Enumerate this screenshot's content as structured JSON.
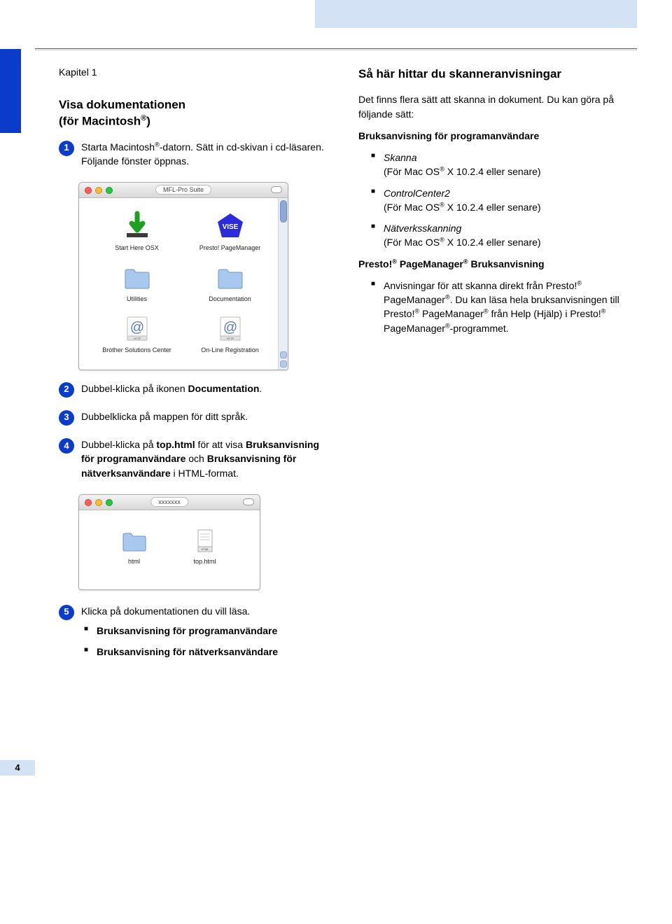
{
  "chapter_label": "Kapitel 1",
  "left": {
    "heading_prefix": "Visa dokumentationen",
    "heading_for": "(för Macintosh",
    "heading_close": ")",
    "step1_a": "Starta Macintosh",
    "step1_b": "-datorn. Sätt in cd-skivan i cd-läsaren. Följande fönster öppnas.",
    "window1_title": "MFL-Pro Suite",
    "items": {
      "start_here": "Start Here OSX",
      "presto": "Presto! PageManager",
      "utilities": "Utilities",
      "documentation": "Documentation",
      "solutions": "Brother Solutions Center",
      "online": "On-Line Registration"
    },
    "step2_a": "Dubbel-klicka på ikonen ",
    "step2_b": "Documentation",
    "step2_c": ".",
    "step3": "Dubbelklicka på mappen för ditt språk.",
    "step4_a": "Dubbel-klicka på ",
    "step4_b": "top.html",
    "step4_c": " för att visa ",
    "step4_d": "Bruksanvisning för programanvändare",
    "step4_e": " och ",
    "step4_f": "Bruksanvisning för nätverksanvändare",
    "step4_g": " i HTML-format.",
    "window2_title": "xxxxxxx",
    "items2": {
      "html": "html",
      "tophtml": "top.html"
    },
    "step5": "Klicka på dokumentationen du vill läsa.",
    "step5_li1": "Bruksanvisning för programanvändare",
    "step5_li2": "Bruksanvisning för nätverksanvändare"
  },
  "right": {
    "heading": "Så här hittar du skanneranvisningar",
    "intro": "Det finns flera sätt att skanna in dokument. Du kan göra på följande sätt:",
    "sub1": "Bruksanvisning för programanvändare",
    "li1_a": "Skanna",
    "li1_b": "(För Mac OS",
    "li1_c": " X 10.2.4 eller senare)",
    "li2_a": "ControlCenter2",
    "li2_b": "(För Mac OS",
    "li2_c": " X 10.2.4 eller senare)",
    "li3_a": "Nätverksskanning",
    "li3_b": "(För Mac OS",
    "li3_c": " X 10.2.4 eller senare)",
    "sub2_a": "Presto!",
    "sub2_b": " PageManager",
    "sub2_c": " Bruksanvisning",
    "li4_a": "Anvisningar för att skanna direkt från Presto!",
    "li4_b": " PageManager",
    "li4_c": ". Du kan läsa hela bruksanvisningen till Presto!",
    "li4_d": " PageManager",
    "li4_e": " från Help (Hjälp) i Presto!",
    "li4_f": " PageManager",
    "li4_g": "-programmet."
  },
  "page_number": "4"
}
